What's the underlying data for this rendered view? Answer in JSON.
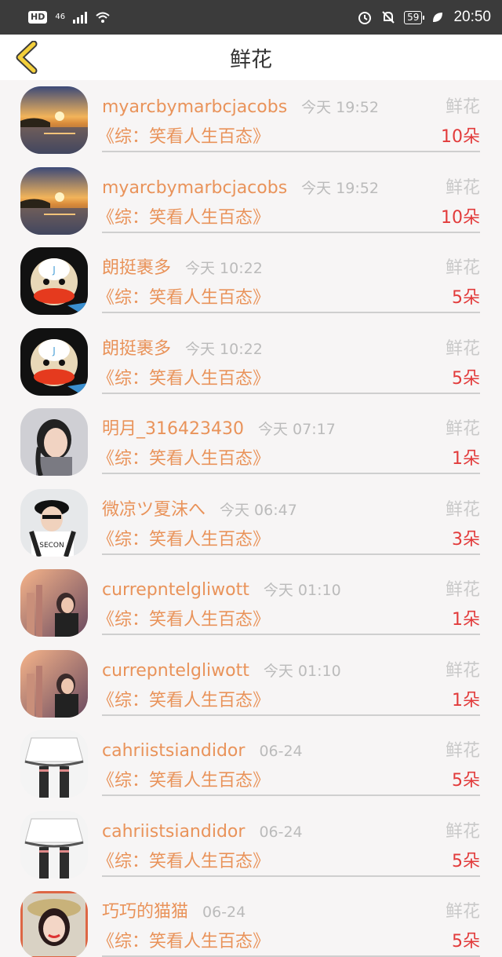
{
  "status_bar": {
    "hd": "HD",
    "network": "46",
    "battery": "59",
    "time": "20:50"
  },
  "header": {
    "title": "鲜花",
    "back_icon": "chevron-left-icon",
    "accent_color": "#f3cf3b"
  },
  "items": [
    {
      "username": "myarcbymarbcjacobs",
      "time": "今天 19:52",
      "gift": "鲜花",
      "book": "《综：笑看人生百态》",
      "amount": "10朵",
      "avatar": "sunset"
    },
    {
      "username": "myarcbymarbcjacobs",
      "time": "今天 19:52",
      "gift": "鲜花",
      "book": "《综：笑看人生百态》",
      "amount": "10朵",
      "avatar": "sunset"
    },
    {
      "username": "朗挺裹多",
      "time": "今天 10:22",
      "gift": "鲜花",
      "book": "《综：笑看人生百态》",
      "amount": "5朵",
      "avatar": "monkey"
    },
    {
      "username": "朗挺裹多",
      "time": "今天 10:22",
      "gift": "鲜花",
      "book": "《综：笑看人生百态》",
      "amount": "5朵",
      "avatar": "monkey"
    },
    {
      "username": "明月_316423430",
      "time": "今天 07:17",
      "gift": "鲜花",
      "book": "《综：笑看人生百态》",
      "amount": "1朵",
      "avatar": "girl"
    },
    {
      "username": "微凉ツ夏沫へ",
      "time": "今天 06:47",
      "gift": "鲜花",
      "book": "《综：笑看人生百态》",
      "amount": "3朵",
      "avatar": "boy"
    },
    {
      "username": "currepntelgliwott",
      "time": "今天 01:10",
      "gift": "鲜花",
      "book": "《综：笑看人生百态》",
      "amount": "1朵",
      "avatar": "city"
    },
    {
      "username": "currepntelgliwott",
      "time": "今天 01:10",
      "gift": "鲜花",
      "book": "《综：笑看人生百态》",
      "amount": "1朵",
      "avatar": "city"
    },
    {
      "username": "cahriistsiandidor",
      "time": "06-24",
      "gift": "鲜花",
      "book": "《综：笑看人生百态》",
      "amount": "5朵",
      "avatar": "skirt"
    },
    {
      "username": "cahriistsiandidor",
      "time": "06-24",
      "gift": "鲜花",
      "book": "《综：笑看人生百态》",
      "amount": "5朵",
      "avatar": "skirt"
    },
    {
      "username": "巧巧的猫猫",
      "time": "06-24",
      "gift": "鲜花",
      "book": "《综：笑看人生百态》",
      "amount": "5朵",
      "avatar": "hat"
    }
  ],
  "colors": {
    "username": "#e9935a",
    "amount": "#e23b3b",
    "muted": "#bbbbbb"
  }
}
